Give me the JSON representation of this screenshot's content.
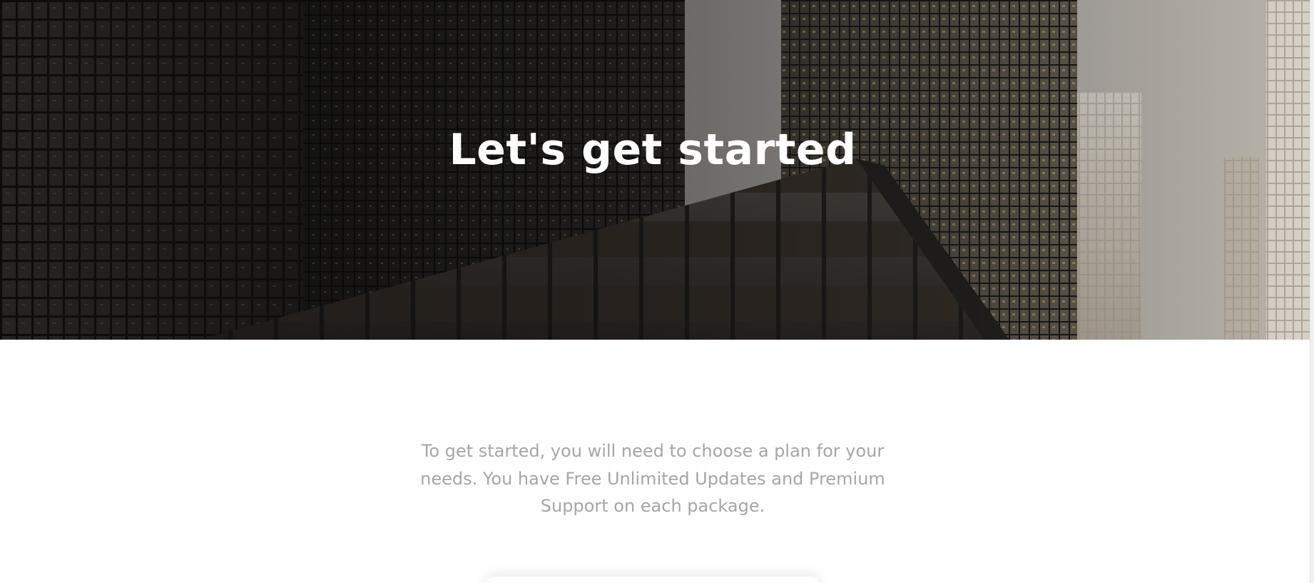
{
  "hero": {
    "title": "Let's get started",
    "nav_button_label": ""
  },
  "intro": {
    "text": "To get started, you will need to choose a plan for your needs. You have Free Unlimited Updates and Premium Support on each package."
  },
  "colors": {
    "hero_title": "#ffffff",
    "intro_text": "#a8a6a4",
    "page_background": "#ffffff"
  }
}
